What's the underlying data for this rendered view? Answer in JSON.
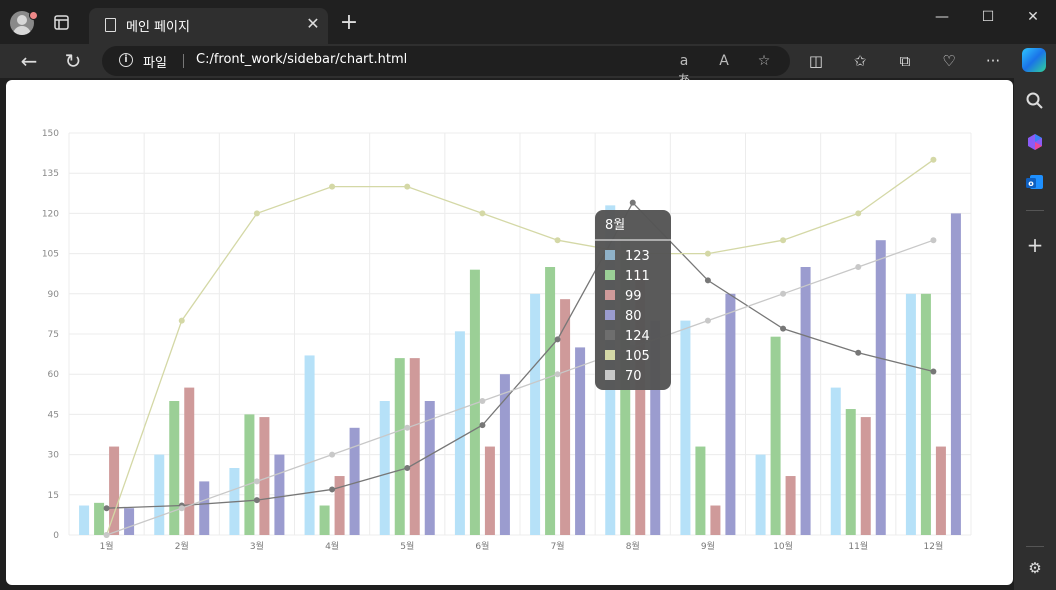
{
  "browser": {
    "tab_title": "메인 페이지",
    "address_scheme": "파일",
    "url": "C:/front_work/sidebar/chart.html",
    "window_controls": {
      "minimize": "—",
      "maximize": "☐",
      "close": "✕"
    },
    "icons": {
      "profile": "profile-avatar-icon",
      "tab_actions": "tab-actions-icon",
      "new_tab": "plus-icon",
      "back": "back-arrow-icon",
      "refresh": "refresh-icon",
      "info": "info-icon",
      "translate": "translate-icon",
      "read_aloud": "read-aloud-icon",
      "favorite": "star-icon",
      "split_screen": "split-screen-icon",
      "favorites": "favorites-icon",
      "collections": "collections-icon",
      "browser_essentials": "heart-pulse-icon",
      "more": "more-icon",
      "copilot": "copilot-icon"
    },
    "sidebar_icons": [
      "search-icon",
      "copilot-sidebar-icon",
      "outlook-icon",
      "add-icon",
      "settings-icon"
    ]
  },
  "chart_data": {
    "type": "bar+line",
    "categories": [
      "1월",
      "2월",
      "3월",
      "4월",
      "5월",
      "6월",
      "7월",
      "8월",
      "9월",
      "10월",
      "11월",
      "12월"
    ],
    "ylim": [
      0,
      150
    ],
    "yticks": [
      0,
      15,
      30,
      45,
      60,
      75,
      90,
      105,
      120,
      135,
      150
    ],
    "grid": true,
    "bar_series": [
      {
        "color": "#b6e1f8",
        "values": [
          11,
          30,
          25,
          67,
          50,
          76,
          90,
          123,
          80,
          30,
          55,
          90
        ]
      },
      {
        "color": "#9bcf96",
        "values": [
          12,
          50,
          45,
          11,
          66,
          99,
          100,
          111,
          33,
          74,
          47,
          90
        ]
      },
      {
        "color": "#cf9a9a",
        "values": [
          33,
          55,
          44,
          22,
          66,
          33,
          88,
          99,
          11,
          22,
          44,
          33
        ]
      },
      {
        "color": "#9b9ccf",
        "values": [
          10,
          20,
          30,
          40,
          50,
          60,
          70,
          80,
          90,
          100,
          110,
          120
        ]
      }
    ],
    "line_series": [
      {
        "color": "#777777",
        "values": [
          10,
          11,
          13,
          17,
          25,
          41,
          73,
          124,
          95,
          77,
          68,
          61
        ]
      },
      {
        "color": "#d4d8a6",
        "values": [
          0,
          80,
          120,
          130,
          130,
          120,
          110,
          105,
          105,
          110,
          120,
          140
        ]
      },
      {
        "color": "#c8c8c8",
        "values": [
          0,
          10,
          20,
          30,
          40,
          50,
          60,
          70,
          80,
          90,
          100,
          110
        ]
      }
    ],
    "tooltip": {
      "title": "8월",
      "rows": [
        {
          "color": "#8fb1c8",
          "value": "123"
        },
        {
          "color": "#9bcf96",
          "value": "111"
        },
        {
          "color": "#cf9a9a",
          "value": "99"
        },
        {
          "color": "#9b9ccf",
          "value": "80"
        },
        {
          "color": "#6e6e6e",
          "value": "124"
        },
        {
          "color": "#d4d8a6",
          "value": "105"
        },
        {
          "color": "#c8c8c8",
          "value": "70"
        }
      ]
    }
  }
}
